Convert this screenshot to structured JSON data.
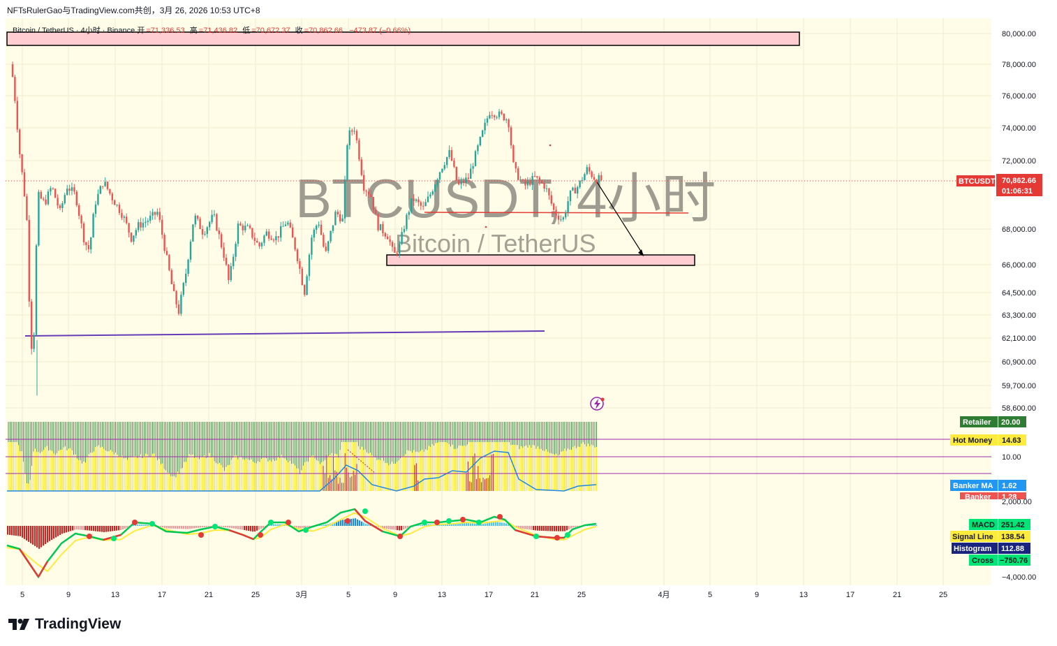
{
  "header": {
    "title": "NFTsRulerGao与TradingView.com共创，3月 26, 2026 10:53 UTC+8"
  },
  "info": {
    "symbol_line": "Bitcoin / TetherUS · 4小时 · Binance",
    "open_label": "开",
    "open_value": "=71,336.53",
    "high_label": "高",
    "high_value": "=71,436.82",
    "low_label": "低",
    "low_value": "=70,672.37",
    "close_label": "收",
    "close_value": "=70,862.66",
    "change_value": "−473.87 (−0.66%)"
  },
  "watermark": {
    "main": "BTCUSDT, 4小时",
    "sub": "Bitcoin / TetherUS"
  },
  "price_tag": {
    "symbol": "BTCUSDT",
    "price": "70,862.66",
    "countdown": "01:06:31"
  },
  "indicator_tags": {
    "retailer_label": "Retailer",
    "retailer_value": "20.00",
    "hotmoney_label": "Hot Money",
    "hotmoney_value": "14.63",
    "bankerma_label": "Banker MA",
    "bankerma_value": "1.62",
    "banker_label": "Banker",
    "banker_value": "1.28",
    "level_10": "10.00",
    "macd_label": "MACD",
    "macd_value": "251.42",
    "signal_label": "Signal Line",
    "signal_value": "138.54",
    "hist_label": "Histogram",
    "hist_value": "112.88",
    "cross_label": "Cross",
    "cross_value": "−750.76",
    "osc_top": "2,000.00",
    "osc_bottom": "−4,000.00"
  },
  "footer": {
    "brand": "TradingView"
  },
  "colors": {
    "up": "#26a69a",
    "down": "#ef5350",
    "support": "#7e57c2",
    "zone": "#ffcdd2",
    "bg": "#fffde7"
  },
  "chart_data": {
    "type": "candlestick",
    "title": "BTCUSDT, 4小时",
    "y_ticks": [
      "80,000.00",
      "78,000.00",
      "76,000.00",
      "74,000.00",
      "72,000.00",
      "68,000.00",
      "66,000.00",
      "64,500.00",
      "63,300.00",
      "62,100.00",
      "60,900.00",
      "59,700.00",
      "58,600.00"
    ],
    "x_ticks": [
      "5",
      "9",
      "13",
      "17",
      "21",
      "25",
      "3月",
      "5",
      "9",
      "13",
      "17",
      "21",
      "25",
      "4月",
      "5",
      "9",
      "13",
      "17",
      "21",
      "25"
    ],
    "price_path": [
      [
        0,
        78000
      ],
      [
        5,
        76000
      ],
      [
        12,
        72500
      ],
      [
        22,
        69000
      ],
      [
        28,
        61500
      ],
      [
        33,
        62500
      ],
      [
        38,
        70000
      ],
      [
        48,
        69500
      ],
      [
        58,
        70500
      ],
      [
        70,
        69000
      ],
      [
        80,
        70500
      ],
      [
        92,
        70000
      ],
      [
        105,
        67300
      ],
      [
        112,
        66800
      ],
      [
        120,
        69500
      ],
      [
        132,
        70800
      ],
      [
        145,
        69800
      ],
      [
        160,
        68800
      ],
      [
        172,
        67500
      ],
      [
        182,
        68200
      ],
      [
        195,
        68500
      ],
      [
        210,
        69000
      ],
      [
        222,
        66500
      ],
      [
        232,
        64500
      ],
      [
        240,
        63500
      ],
      [
        250,
        65500
      ],
      [
        262,
        68800
      ],
      [
        275,
        67800
      ],
      [
        290,
        68800
      ],
      [
        305,
        66500
      ],
      [
        312,
        65000
      ],
      [
        325,
        68200
      ],
      [
        340,
        68000
      ],
      [
        355,
        67000
      ],
      [
        365,
        67800
      ],
      [
        380,
        67500
      ],
      [
        395,
        68500
      ],
      [
        408,
        66800
      ],
      [
        420,
        64500
      ],
      [
        430,
        67500
      ],
      [
        440,
        68500
      ],
      [
        450,
        66500
      ],
      [
        465,
        69000
      ],
      [
        475,
        68500
      ],
      [
        482,
        73500
      ],
      [
        492,
        74000
      ],
      [
        505,
        70500
      ],
      [
        515,
        70000
      ],
      [
        525,
        68200
      ],
      [
        540,
        67600
      ],
      [
        548,
        66500
      ],
      [
        556,
        67000
      ],
      [
        565,
        68500
      ],
      [
        575,
        69800
      ],
      [
        590,
        69200
      ],
      [
        600,
        70000
      ],
      [
        615,
        71500
      ],
      [
        628,
        72500
      ],
      [
        640,
        70500
      ],
      [
        655,
        71000
      ],
      [
        670,
        73000
      ],
      [
        685,
        75000
      ],
      [
        700,
        74800
      ],
      [
        712,
        74500
      ],
      [
        720,
        71500
      ],
      [
        735,
        70500
      ],
      [
        750,
        71000
      ],
      [
        765,
        70500
      ],
      [
        778,
        69000
      ],
      [
        790,
        68500
      ],
      [
        800,
        70000
      ],
      [
        812,
        70500
      ],
      [
        825,
        71500
      ],
      [
        835,
        71000
      ],
      [
        846,
        70862
      ]
    ]
  }
}
